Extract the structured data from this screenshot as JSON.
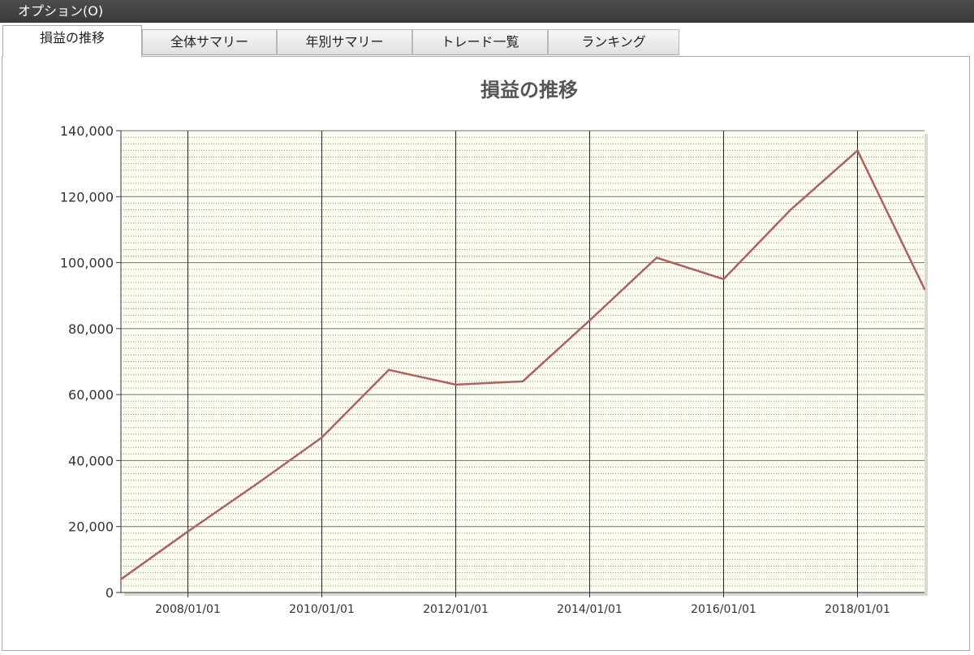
{
  "menubar": {
    "options_label": "オプション(O)"
  },
  "tabs": [
    {
      "label": "損益の推移",
      "active": true
    },
    {
      "label": "全体サマリー",
      "active": false
    },
    {
      "label": "年別サマリー",
      "active": false
    },
    {
      "label": "トレード一覧",
      "active": false
    },
    {
      "label": "ランキング",
      "active": false
    }
  ],
  "colors": {
    "line": "#b06060",
    "plot_background": "#fdfdf0",
    "major_grid": "#000000",
    "minor_grid": "#8a8a8a"
  },
  "chart_data": {
    "type": "line",
    "title": "損益の推移",
    "xlabel": "",
    "ylabel": "",
    "ylim": [
      0,
      140000
    ],
    "xlim": [
      "2007/01/01",
      "2019/01/01"
    ],
    "grid": true,
    "yticks": [
      "0",
      "20,000",
      "40,000",
      "60,000",
      "80,000",
      "100,000",
      "120,000",
      "140,000"
    ],
    "xticks": [
      "2008/01/01",
      "2010/01/01",
      "2012/01/01",
      "2014/01/01",
      "2016/01/01",
      "2018/01/01"
    ],
    "series": [
      {
        "x": [
          "2007/01/01",
          "2008/01/01",
          "2009/01/01",
          "2010/01/01",
          "2011/01/01",
          "2012/01/01",
          "2013/01/01",
          "2014/01/01",
          "2015/01/01",
          "2016/01/01",
          "2017/01/01",
          "2018/01/01",
          "2019/01/01"
        ],
        "values": [
          4000,
          18500,
          32500,
          47000,
          67500,
          63000,
          64000,
          82500,
          101500,
          95000,
          116000,
          134000,
          92000
        ]
      }
    ]
  }
}
